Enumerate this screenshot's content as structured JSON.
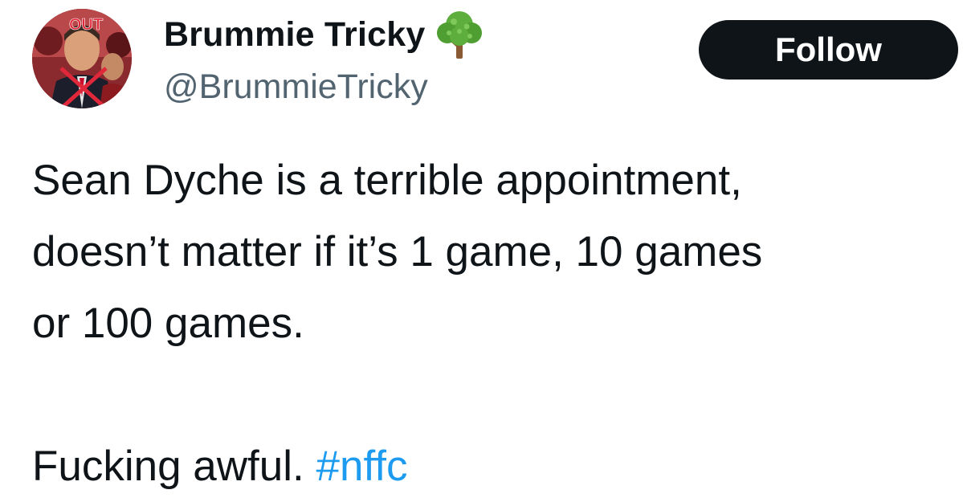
{
  "author": {
    "display_name": "Brummie Tricky",
    "handle": "@BrummieTricky",
    "emoji_icon": "tree-icon",
    "avatar_overlay_text": "OUT"
  },
  "follow_button": {
    "label": "Follow"
  },
  "tweet": {
    "lines": [
      "Sean Dyche is a terrible appointment,",
      "doesn’t matter if it’s 1 game, 10 games",
      "or 100 games."
    ],
    "closing_text": "Fucking awful.",
    "hashtag": "#nffc"
  },
  "colors": {
    "text": "#0f1419",
    "secondary_text": "#536471",
    "button_bg": "#0f1419",
    "button_text": "#ffffff",
    "link": "#1d9bf0"
  }
}
